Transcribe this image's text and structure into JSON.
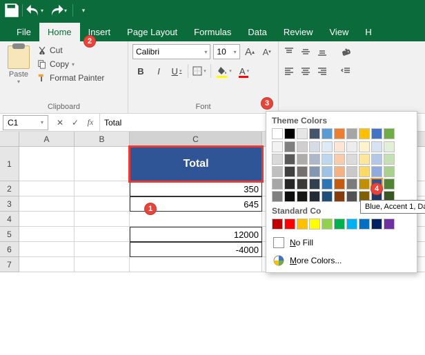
{
  "tabs": {
    "file": "File",
    "home": "Home",
    "insert": "Insert",
    "page_layout": "Page Layout",
    "formulas": "Formulas",
    "data": "Data",
    "review": "Review",
    "view": "View"
  },
  "ribbon": {
    "clipboard": {
      "paste": "Paste",
      "cut": "Cut",
      "copy": "Copy",
      "format_painter": "Format Painter",
      "group_label": "Clipboard"
    },
    "font": {
      "name": "Calibri",
      "size": "10",
      "group_label": "Font",
      "bold": "B",
      "italic": "I",
      "underline": "U",
      "font_color_letter": "A"
    }
  },
  "formula_bar": {
    "name_box": "C1",
    "fx_label": "fx",
    "value": "Total"
  },
  "columns": [
    "A",
    "B",
    "C"
  ],
  "rows": [
    "1",
    "2",
    "3",
    "4",
    "5",
    "6",
    "7"
  ],
  "cells": {
    "c1": "Total",
    "c2_partial": "350",
    "c3_partial": "645",
    "c5": "12000",
    "c6": "-4000"
  },
  "fill_popup": {
    "theme_label": "Theme Colors",
    "standard_label": "Standard Co",
    "no_fill": "No Fill",
    "more_colors": "More Colors...",
    "tooltip_partial": "Blue, Accent 1, Da",
    "theme_row_main": [
      "#ffffff",
      "#000000",
      "#e7e6e6",
      "#44546a",
      "#5b9bd5",
      "#ed7d31",
      "#a5a5a5",
      "#ffc000",
      "#4472c4",
      "#70ad47"
    ],
    "theme_tints": [
      [
        "#f2f2f2",
        "#7f7f7f",
        "#d0cece",
        "#d6dce5",
        "#deebf7",
        "#fbe5d6",
        "#ededed",
        "#fff2cc",
        "#d9e2f3",
        "#e2f0d9"
      ],
      [
        "#d9d9d9",
        "#595959",
        "#aeabab",
        "#adb9ca",
        "#bdd7ee",
        "#f8cbad",
        "#dbdbdb",
        "#ffe699",
        "#b4c7e7",
        "#c5e0b4"
      ],
      [
        "#bfbfbf",
        "#404040",
        "#757070",
        "#8497b0",
        "#9cc3e6",
        "#f4b183",
        "#c9c9c9",
        "#ffd966",
        "#8faadc",
        "#a9d18e"
      ],
      [
        "#a6a6a6",
        "#262626",
        "#3b3838",
        "#323f4f",
        "#2e75b6",
        "#c55a11",
        "#7b7b7b",
        "#bf9000",
        "#2f5597",
        "#548235"
      ],
      [
        "#808080",
        "#0d0d0d",
        "#171716",
        "#222a35",
        "#1f4e79",
        "#843c0c",
        "#525252",
        "#806000",
        "#203864",
        "#385723"
      ]
    ],
    "standard_row": [
      "#c00000",
      "#ff0000",
      "#ffc000",
      "#ffff00",
      "#92d050",
      "#00b050",
      "#00b0f0",
      "#0070c0",
      "#002060",
      "#7030a0"
    ]
  },
  "annotations": {
    "b1": "1",
    "b2": "2",
    "b3": "3",
    "b4": "4"
  }
}
